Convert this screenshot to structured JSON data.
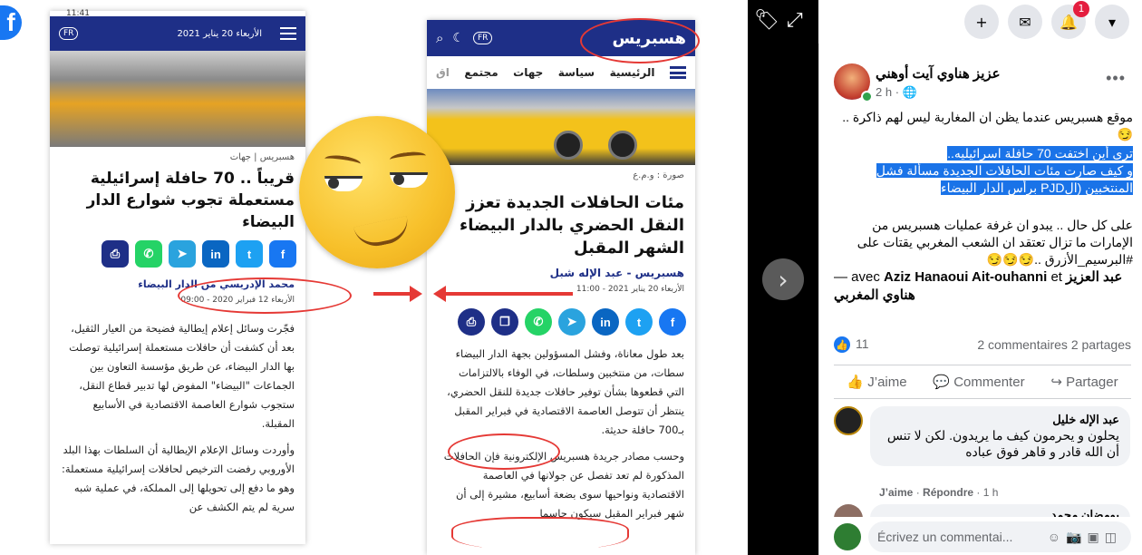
{
  "accent": "#1877f2",
  "topbar": {
    "notifications": "1"
  },
  "photo": {
    "left": {
      "status_time": "11:41",
      "date": "الأربعاء 20 يناير 2021",
      "lang": "FR",
      "crumb_site": "هسبريس",
      "crumb_section": "جهات",
      "title": "قريباً .. 70 حافلة إسرائيلية مستعملة تجوب شوارع الدار البيضاء",
      "author": "محمد الإدريسي من الدار البيضاء",
      "published": "الأربعاء 12 فبراير 2020 - 09:00",
      "para1": "فجّرت وسائل إعلام إيطالية فضيحة من العيار الثقيل، بعد أن كشفت أن حافلات مستعملة إسرائيلية توصلت بها الدار البيضاء، عن طريق مؤسسة التعاون بين الجماعات \"البيضاء\" المفوض لها تدبير قطاع النقل، ستجوب شوارع العاصمة الاقتصادية في الأسابيع المقبلة.",
      "para2": "وأوردت وسائل الإعلام الإيطالية أن السلطات بهذا البلد الأوروبي رفضت الترخيص لحافلات إسرائيلية مستعملة: وهو ما دفع إلى تحويلها إلى المملكة، في عملية شبه سرية لم يتم الكشف عن"
    },
    "right": {
      "logo": "هسبريس",
      "lang": "FR",
      "nav": [
        "الرئيسية",
        "سياسة",
        "جهات",
        "مجتمع",
        "اق"
      ],
      "caption": "صورة : و.م.ع",
      "title": "مئات الحافلات الجديدة تعزز النقل الحضري بالدار البيضاء الشهر المقبل",
      "author": "هسبريس - عبد الإله شبل",
      "published": "الأربعاء 20 يناير 2021 - 11:00",
      "para1": "بعد طول معاناة، وفشل المسؤولين بجهة الدار البيضاء سطات، من منتخبين وسلطات، في الوفاء بالالتزامات التي قطعوها بشأن توفير حافلات جديدة للنقل الحضري، ينتظر أن تتوصل العاصمة الاقتصادية في فبراير المقبل بـ700 حافلة حديثة.",
      "para2": "وحسب مصادر جريدة هسبريس الإلكترونية فإن الحافلات المذكورة لم تعد تفصل عن جولانها في العاصمة الاقتصادية ونواحيها سوى بضعة أسابيع، مشيرة إلى أن شهر فبراير المقبل سيكون حاسما"
    },
    "share_icons": [
      "print-icon",
      "whatsapp-icon",
      "telegram-icon",
      "linkedin-icon",
      "twitter-icon",
      "facebook-icon"
    ]
  },
  "post": {
    "author": "عزيز هناوي آيت أوهني",
    "time": "2 h",
    "line1": "موقع هسبريس عندما يظن ان المغاربة ليس لهم ذاكرة ..😏",
    "highlight1": "ترى أين اختفت 70 حافلة اسرائيليه..",
    "highlight2": "و كيف صارت مئات الحافلات الجديدة مسألة فشل المنتخبين (الPJD برأس الدار البيضاء",
    "line2": "على كل حال .. يبدو ان غرفة عمليات هسبريس من الإمارات ما تزال تعتقد ان الشعب المغربي يقتات على #البرسيم_الأزرق ..😏😏😏",
    "tag_prefix": "— avec",
    "tag_person1": "Aziz Hanaoui Ait-ouhanni",
    "tag_et": "et",
    "tag_person2": "عبد العزيز هناوي المغربي",
    "reactions": "11",
    "comments_count": "2 commentaires",
    "shares_count": "2 partages",
    "like_label": "J’aime",
    "comment_label": "Commenter",
    "share_label": "Partager"
  },
  "comment": {
    "name": "عبد الإله خليل",
    "text": "يحلون و يحرمون كيف ما يريدون. لكن لا تنس أن الله قادر و قاهر فوق عباده",
    "like": "J’aime",
    "reply": "Répondre",
    "time": "1 h",
    "next_name": "بومضان محمد"
  },
  "composer": {
    "placeholder": "Écrivez un commentai..."
  }
}
